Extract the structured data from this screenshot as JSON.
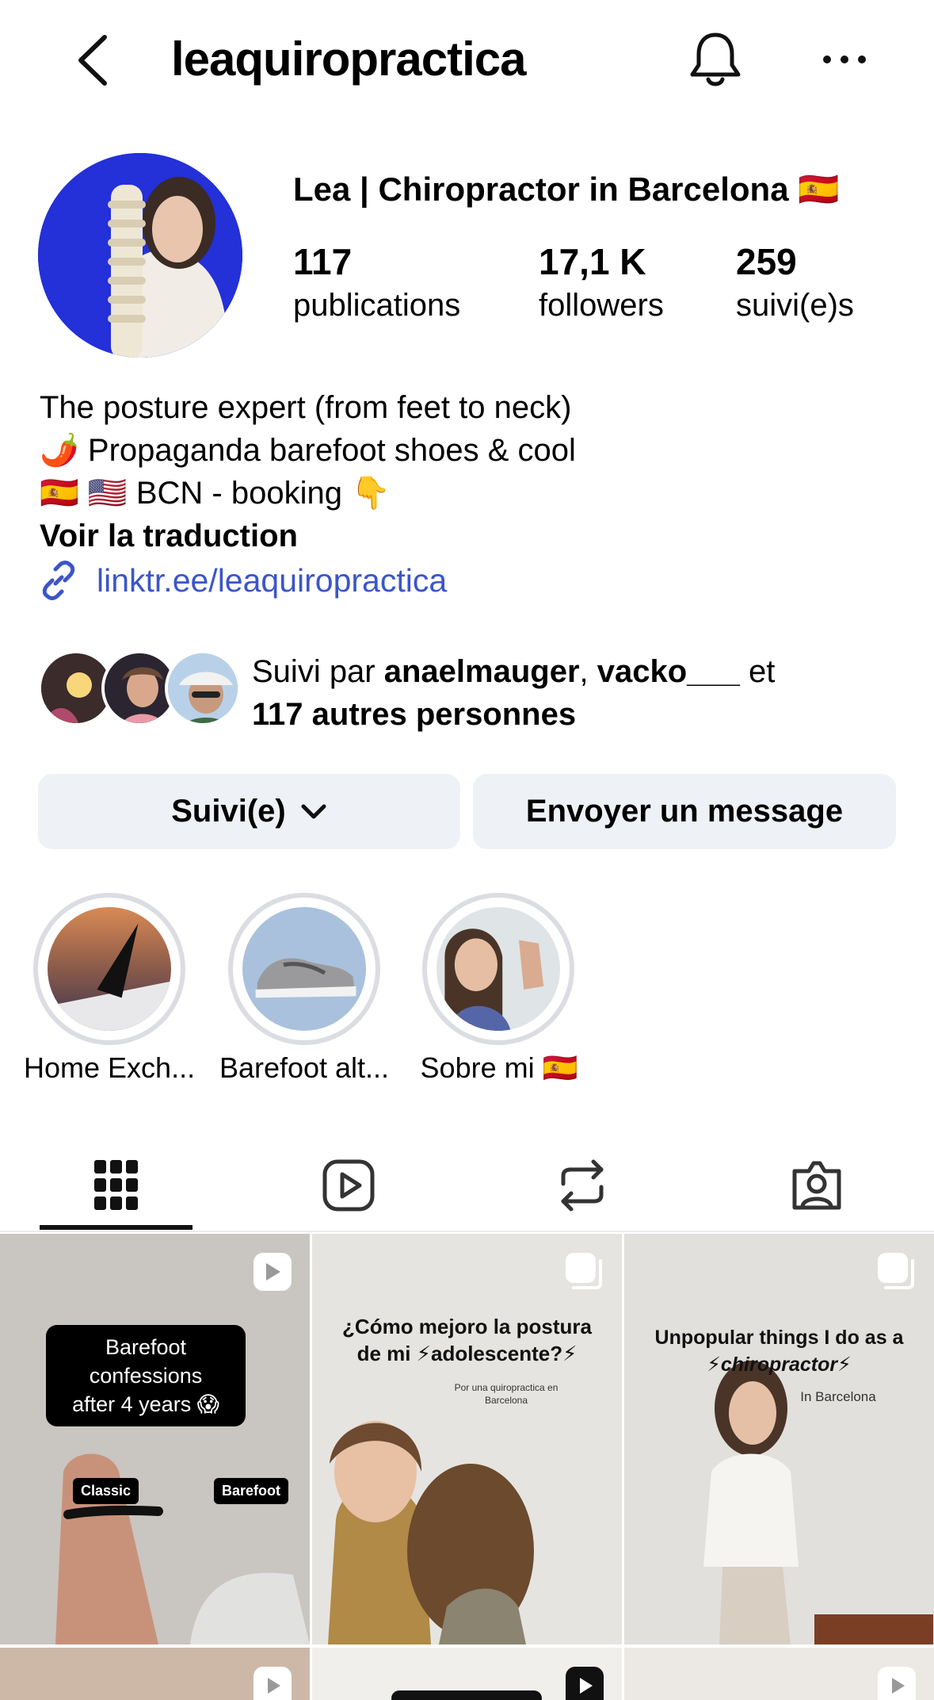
{
  "header": {
    "username": "leaquiropractica"
  },
  "profile": {
    "display_name": "Lea | Chiropractor in Barcelona 🇪🇸",
    "stats": [
      {
        "value": "117",
        "label": "publications"
      },
      {
        "value": "17,1 K",
        "label": "followers"
      },
      {
        "value": "259",
        "label": "suivi(e)s"
      }
    ],
    "bio": [
      "The posture expert (from feet to neck)",
      "🌶️ Propaganda barefoot shoes & cool",
      "🇪🇸  🇺🇸  BCN - booking  👇"
    ],
    "translate_label": "Voir la traduction",
    "link": "linktr.ee/leaquiropractica",
    "followed_by": {
      "prefix": "Suivi par ",
      "user1": "anaelmauger",
      "separator": ", ",
      "user2": "vacko___",
      "suffix": " et",
      "others": "117 autres personnes"
    }
  },
  "actions": {
    "following_label": "Suivi(e)",
    "message_label": "Envoyer un message"
  },
  "highlights": [
    {
      "label": "Home Exch..."
    },
    {
      "label": "Barefoot alt..."
    },
    {
      "label": "Sobre mi 🇪🇸"
    }
  ],
  "tabs": [
    {
      "icon": "grid-icon",
      "active": true
    },
    {
      "icon": "reels-icon",
      "active": false
    },
    {
      "icon": "reposts-icon",
      "active": false
    },
    {
      "icon": "tagged-icon",
      "active": false
    }
  ],
  "posts": [
    {
      "type": "reel",
      "title_lines": [
        "Barefoot confessions",
        "after 4 years 😱"
      ],
      "tag_left": "Classic",
      "tag_right": "Barefoot"
    },
    {
      "type": "carousel",
      "title_lines": [
        "¿Cómo mejoro la postura",
        "de mi ⚡adolescente?⚡"
      ],
      "subtitle_lines": [
        "Por una quiropractica en",
        "Barcelona"
      ]
    },
    {
      "type": "carousel",
      "title_lines": [
        "Unpopular things I do as a",
        "⚡chiropractor⚡"
      ],
      "subtitle": "In Barcelona"
    }
  ],
  "colors": {
    "link": "#3b55c9",
    "button_bg": "#eef1f5",
    "avatar_bg": "#2233dd"
  }
}
